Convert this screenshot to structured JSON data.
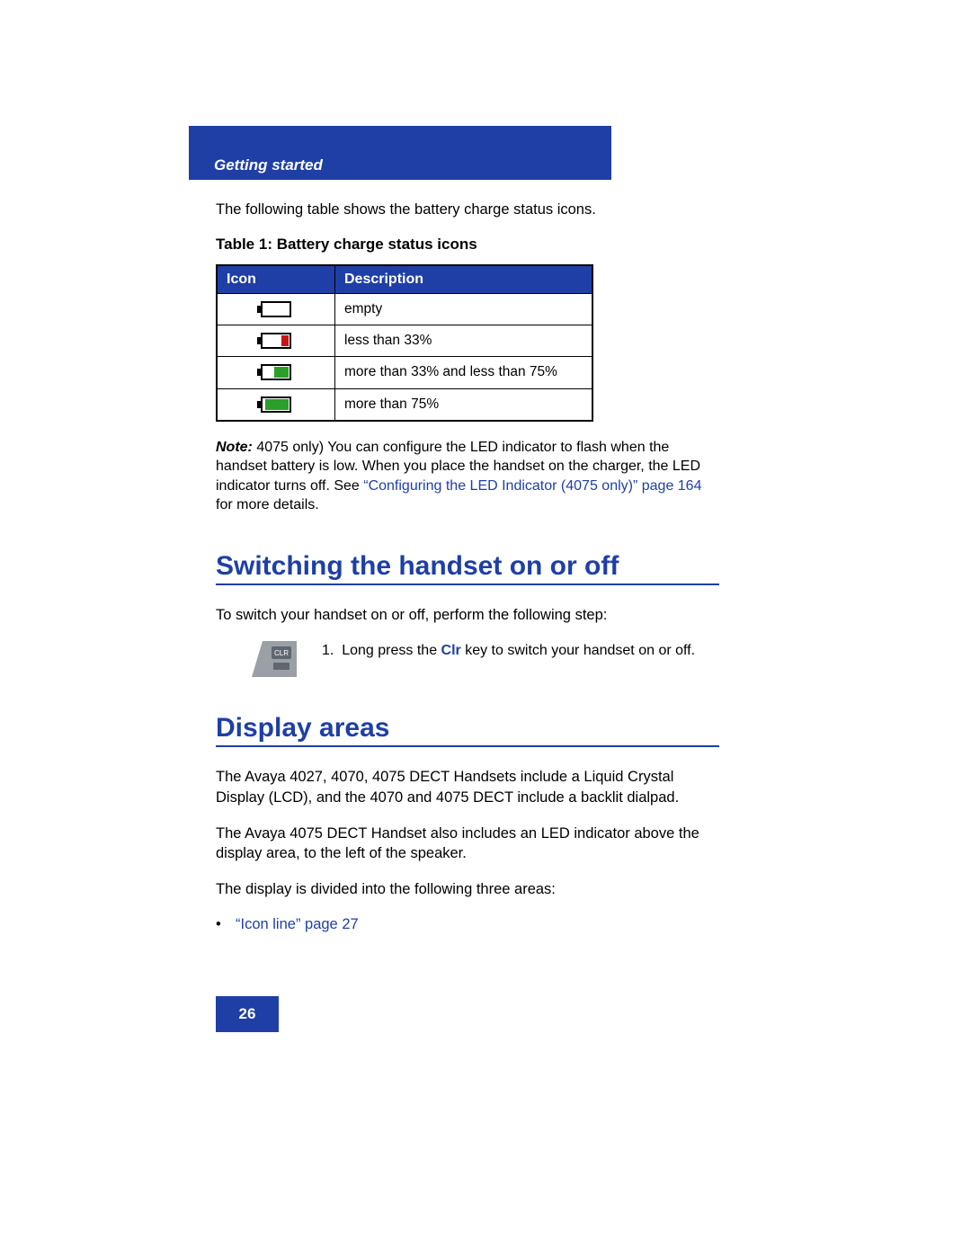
{
  "header": {
    "section": "Getting started"
  },
  "intro": "The following table shows the battery charge status icons.",
  "table": {
    "caption": "Table 1: Battery charge status icons",
    "headers": {
      "icon": "Icon",
      "description": "Description"
    },
    "rows": [
      {
        "icon": "battery-empty-icon",
        "description": "empty"
      },
      {
        "icon": "battery-low-icon",
        "description": "less than 33%"
      },
      {
        "icon": "battery-mid-icon",
        "description": "more than 33% and less than 75%"
      },
      {
        "icon": "battery-high-icon",
        "description": "more than 75%"
      }
    ]
  },
  "note": {
    "label": "Note:",
    "text_before_link": " 4075 only) You can configure the LED indicator to flash when the handset battery is low. When you place the handset on the charger, the LED indicator turns off. See ",
    "link": "“Configuring the LED Indicator (4075 only)” page 164",
    "text_after_link": " for more details."
  },
  "sections": {
    "switching": {
      "heading": "Switching the handset on or off",
      "intro": "To switch your handset on or off, perform the following step:",
      "step_number": "1.",
      "step_before_key": "Long press the ",
      "key_name": "Clr",
      "step_after_key": " key to switch your handset on or off."
    },
    "display_areas": {
      "heading": "Display areas",
      "para1": "The Avaya 4027, 4070, 4075 DECT Handsets include a Liquid Crystal Display (LCD), and the 4070 and 4075 DECT include a backlit dialpad.",
      "para2": "The Avaya 4075 DECT Handset also includes an LED indicator above the display area, to the left of the speaker.",
      "para3": "The display is divided into the following three areas:",
      "bullet_link": "“Icon line” page 27"
    }
  },
  "page_number": "26"
}
